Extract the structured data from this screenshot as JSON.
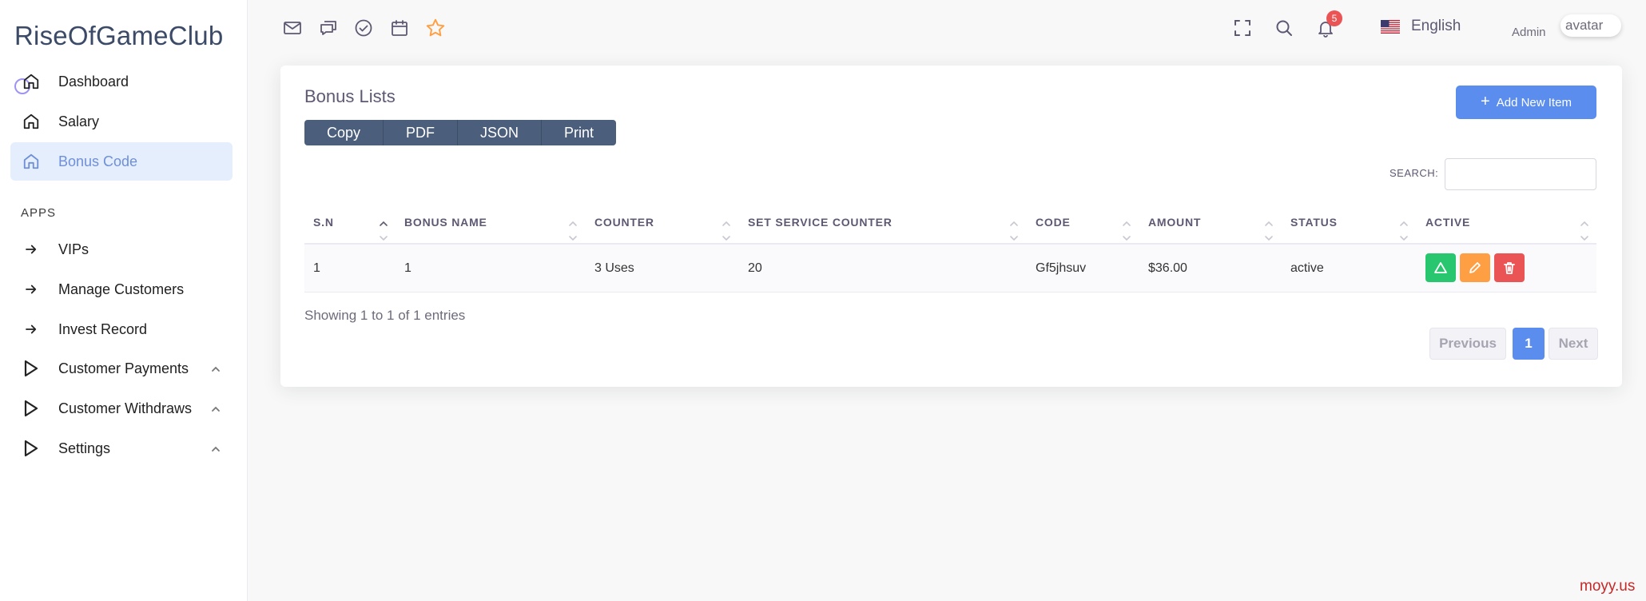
{
  "brand": {
    "name": "RiseOfGameClub"
  },
  "sidebar": {
    "items": [
      {
        "label": "Dashboard",
        "icon": "home-icon"
      },
      {
        "label": "Salary",
        "icon": "home-icon"
      },
      {
        "label": "Bonus Code",
        "icon": "home-icon",
        "active": true
      }
    ],
    "section_label": "APPS",
    "apps": [
      {
        "label": "VIPs",
        "icon": "arrow-right-icon"
      },
      {
        "label": "Manage Customers",
        "icon": "arrow-right-icon"
      },
      {
        "label": "Invest Record",
        "icon": "arrow-right-icon"
      },
      {
        "label": "Customer Payments",
        "icon": "play-icon",
        "expandable": true
      },
      {
        "label": "Customer Withdraws",
        "icon": "play-icon",
        "expandable": true
      },
      {
        "label": "Settings",
        "icon": "play-icon",
        "expandable": true
      }
    ]
  },
  "header": {
    "shortcut_icons": [
      "mail-icon",
      "chat-icon",
      "check-circle-icon",
      "calendar-icon",
      "star-icon"
    ],
    "language": "English",
    "notification_count": "5",
    "user_role": "Admin",
    "avatar_alt": "avatar"
  },
  "colors": {
    "accent": "#5b8def",
    "star": "#ff9f43",
    "success": "#28c76f",
    "warning": "#ff9f43",
    "danger": "#ea5455",
    "export_bg": "#4b5e7b"
  },
  "card": {
    "title": "Bonus Lists",
    "export_buttons": [
      "Copy",
      "PDF",
      "JSON",
      "Print"
    ],
    "add_button": "Add New Item",
    "search_label": "SEARCH:",
    "search_value": ""
  },
  "table": {
    "columns": [
      "S.N",
      "BONUS NAME",
      "COUNTER",
      "SET SERVICE COUNTER",
      "CODE",
      "AMOUNT",
      "STATUS",
      "ACTIVE"
    ],
    "rows": [
      {
        "sn": "1",
        "bonus_name": "1",
        "counter": "3 Uses",
        "set_service_counter": "20",
        "code": "Gf5jhsuv",
        "amount": "$36.00",
        "status": "active"
      }
    ],
    "showing": "Showing 1 to 1 of 1 entries",
    "pagination": {
      "previous": "Previous",
      "current": "1",
      "next": "Next"
    }
  },
  "watermark": "moyy.us"
}
